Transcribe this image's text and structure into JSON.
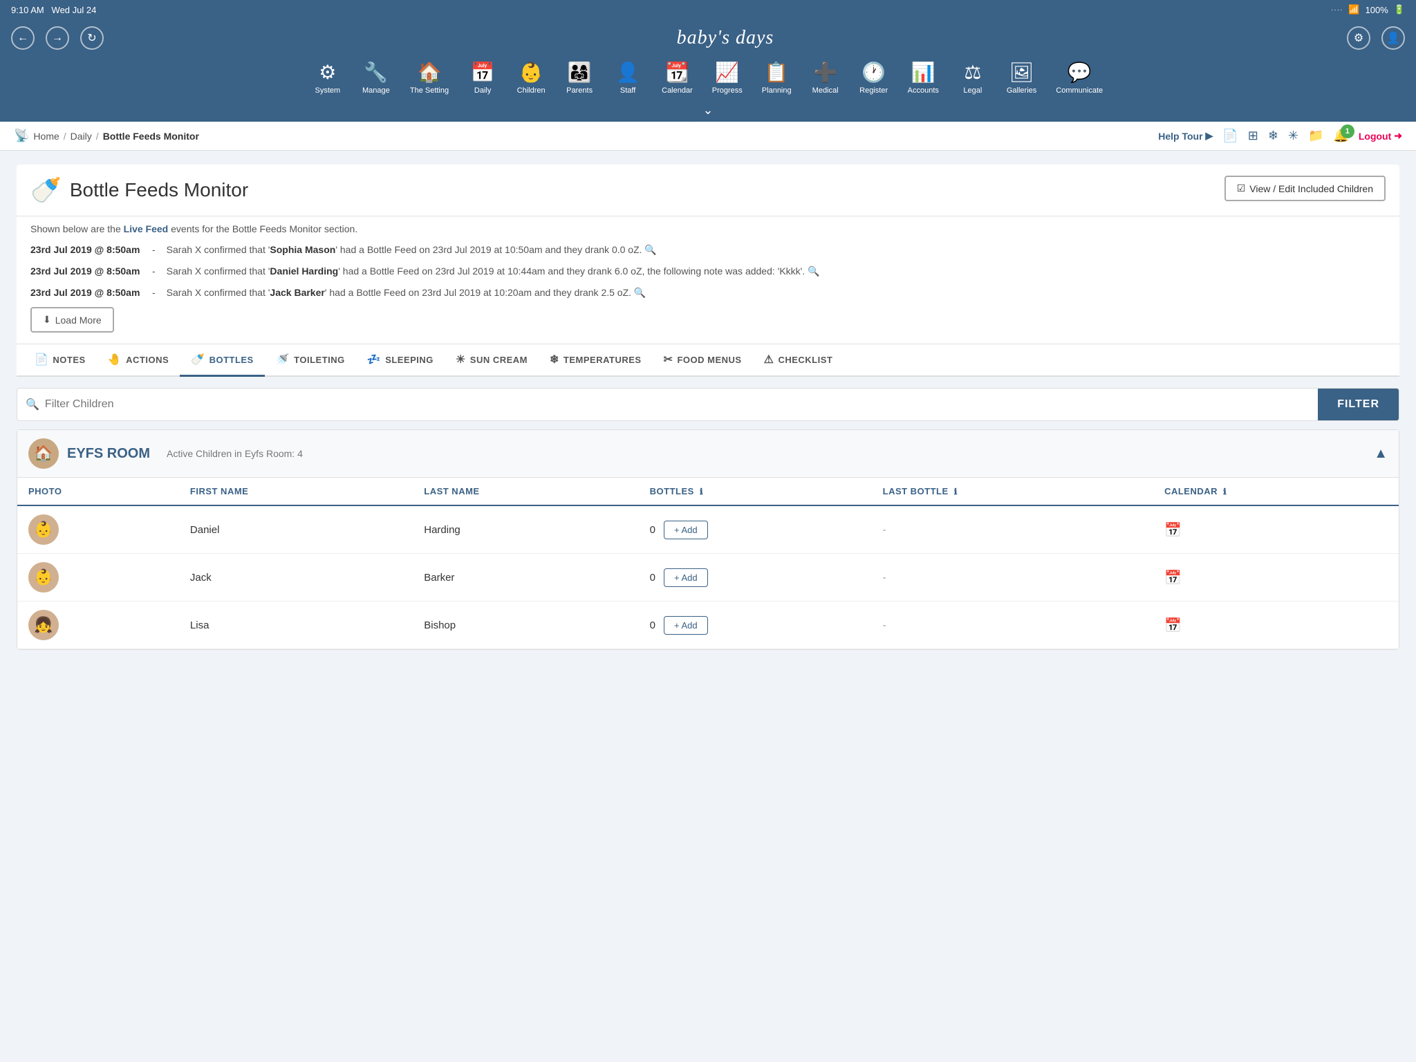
{
  "statusBar": {
    "time": "9:10 AM",
    "date": "Wed Jul 24",
    "battery": "100%",
    "batteryIcon": "🔋"
  },
  "appTitle": "baby's days",
  "nav": {
    "back": "←",
    "forward": "→",
    "refresh": "↻",
    "settings": "⚙",
    "user": "👤"
  },
  "menuItems": [
    {
      "id": "system",
      "icon": "⚙",
      "label": "System"
    },
    {
      "id": "manage",
      "icon": "🔧",
      "label": "Manage"
    },
    {
      "id": "the-setting",
      "icon": "🏠",
      "label": "The Setting"
    },
    {
      "id": "daily",
      "icon": "📅",
      "label": "Daily"
    },
    {
      "id": "children",
      "icon": "👶",
      "label": "Children"
    },
    {
      "id": "parents",
      "icon": "👨‍👩‍👧",
      "label": "Parents"
    },
    {
      "id": "staff",
      "icon": "👤",
      "label": "Staff"
    },
    {
      "id": "calendar",
      "icon": "📆",
      "label": "Calendar"
    },
    {
      "id": "progress",
      "icon": "📈",
      "label": "Progress"
    },
    {
      "id": "planning",
      "icon": "📋",
      "label": "Planning"
    },
    {
      "id": "medical",
      "icon": "➕",
      "label": "Medical"
    },
    {
      "id": "register",
      "icon": "🕐",
      "label": "Register"
    },
    {
      "id": "accounts",
      "icon": "📊",
      "label": "Accounts"
    },
    {
      "id": "legal",
      "icon": "⚖",
      "label": "Legal"
    },
    {
      "id": "galleries",
      "icon": "👤",
      "label": "Galleries"
    },
    {
      "id": "communicate",
      "icon": "💬",
      "label": "Communicate"
    }
  ],
  "breadcrumb": {
    "home": "Home",
    "daily": "Daily",
    "current": "Bottle Feeds Monitor"
  },
  "helpTour": "Help Tour",
  "logout": "Logout",
  "notifCount": "1",
  "pageTitle": "Bottle Feeds Monitor",
  "pageIcon": "🍼",
  "viewEditBtn": "View / Edit Included Children",
  "liveFeedDesc1": "Shown below are the ",
  "liveFeedLink": "Live Feed",
  "liveFeedDesc2": " events for the Bottle Feeds Monitor section.",
  "feedEntries": [
    {
      "date": "23rd Jul 2019 @ 8:50am",
      "text1": "Sarah X confirmed that '",
      "childName": "Sophia Mason",
      "text2": "' had a Bottle Feed on 23rd Jul 2019 at 10:50am and they drank 0.0 oZ."
    },
    {
      "date": "23rd Jul 2019 @ 8:50am",
      "text1": "Sarah X confirmed that '",
      "childName": "Daniel Harding",
      "text2": "' had a Bottle Feed on 23rd Jul 2019 at 10:44am and they drank 6.0 oZ, the following note was added: 'Kkkk'."
    },
    {
      "date": "23rd Jul 2019 @ 8:50am",
      "text1": "Sarah X confirmed that '",
      "childName": "Jack Barker",
      "text2": "' had a Bottle Feed on 23rd Jul 2019 at 10:20am and they drank 2.5 oZ."
    }
  ],
  "loadMoreBtn": "Load More",
  "tabs": [
    {
      "id": "notes",
      "icon": "📄",
      "label": "NOTES",
      "active": false
    },
    {
      "id": "actions",
      "icon": "🤚",
      "label": "ACTIONS",
      "active": false
    },
    {
      "id": "bottles",
      "icon": "🍼",
      "label": "BOTTLES",
      "active": true
    },
    {
      "id": "toileting",
      "icon": "🚿",
      "label": "TOILETING",
      "active": false
    },
    {
      "id": "sleeping",
      "icon": "💤",
      "label": "SLEEPING",
      "active": false
    },
    {
      "id": "sun-cream",
      "icon": "🌞",
      "label": "SUN CREAM",
      "active": false
    },
    {
      "id": "temperatures",
      "icon": "❄",
      "label": "TEMPERATURES",
      "active": false
    },
    {
      "id": "food-menus",
      "icon": "✂",
      "label": "FOOD MENUS",
      "active": false
    },
    {
      "id": "checklist",
      "icon": "⚠",
      "label": "CHECKLIST",
      "active": false
    }
  ],
  "filterPlaceholder": "Filter Children",
  "filterBtn": "FILTER",
  "roomName": "EYFS ROOM",
  "roomCount": "Active Children in Eyfs Room: 4",
  "tableHeaders": {
    "photo": "PHOTO",
    "firstName": "FIRST NAME",
    "lastName": "LAST NAME",
    "bottles": "BOTTLES",
    "lastBottle": "LAST BOTTLE",
    "calendar": "CALENDAR"
  },
  "addBtnLabel": "+ Add",
  "children": [
    {
      "id": 1,
      "firstName": "Daniel",
      "lastName": "Harding",
      "bottles": 0,
      "lastBottle": "-"
    },
    {
      "id": 2,
      "firstName": "Jack",
      "lastName": "Barker",
      "bottles": 0,
      "lastBottle": "-"
    },
    {
      "id": 3,
      "firstName": "Lisa",
      "lastName": "Bishop",
      "bottles": 0,
      "lastBottle": "-"
    }
  ],
  "colors": {
    "navBg": "#3a6186",
    "accent": "#3a6186",
    "activeBorder": "#3a6186",
    "addBtn": "#3a6186",
    "logout": "#cc0033"
  }
}
